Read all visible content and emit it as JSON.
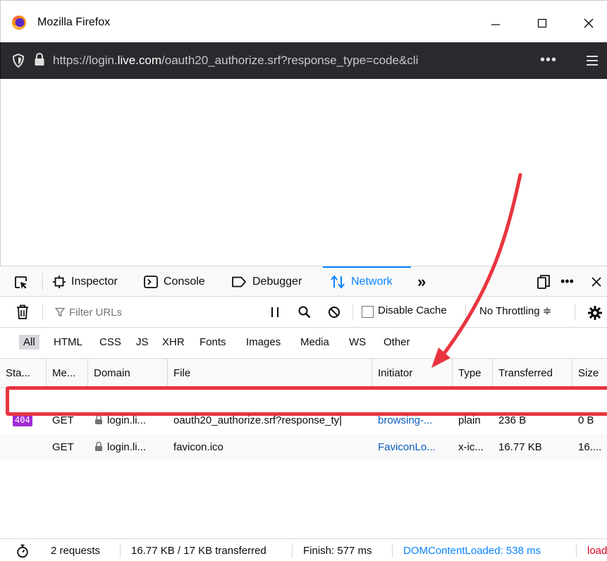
{
  "window": {
    "title": "Mozilla Firefox"
  },
  "urlbar": {
    "url_prefix": "https://login.",
    "url_host": "live.com",
    "url_rest": "/oauth20_authorize.srf?response_type=code&cli",
    "more": "•••"
  },
  "devtools": {
    "tabs": [
      {
        "label": "Inspector",
        "icon": "inspector-icon"
      },
      {
        "label": "Console",
        "icon": "console-icon"
      },
      {
        "label": "Debugger",
        "icon": "debugger-icon"
      },
      {
        "label": "Network",
        "icon": "network-icon",
        "active": true
      }
    ],
    "more_tabs": "»",
    "more_menu": "•••"
  },
  "filterbar": {
    "filter_placeholder": "Filter URLs",
    "disable_cache_label": "Disable Cache",
    "throttling_label": "No Throttling ≑"
  },
  "type_filters": [
    "All",
    "HTML",
    "CSS",
    "JS",
    "XHR",
    "Fonts",
    "Images",
    "Media",
    "WS",
    "Other"
  ],
  "table": {
    "columns": [
      "Sta...",
      "Me...",
      "Domain",
      "File",
      "Initiator",
      "Type",
      "Transferred",
      "Size"
    ],
    "rows": [
      {
        "status": "404",
        "method": "GET",
        "domain": "login.li...",
        "file": "oauth20_authorize.srf?response_ty|",
        "initiator": "browsing-...",
        "type": "plain",
        "transferred": "236 B",
        "size": "0 B"
      },
      {
        "status": "",
        "method": "GET",
        "domain": "login.li...",
        "file": "favicon.ico",
        "initiator": "FaviconLo...",
        "type": "x-ic...",
        "transferred": "16.77 KB",
        "size": "16...."
      }
    ]
  },
  "statusbar": {
    "requests": "2 requests",
    "transferred": "16.77 KB / 17 KB transferred",
    "finish": "Finish: 577 ms",
    "domcontentloaded": "DOMContentLoaded: 538 ms",
    "load": "load"
  },
  "colors": {
    "accent": "#0a84ff",
    "status_404_badge": "#a12ad4",
    "annotation_red": "#e8353f"
  }
}
